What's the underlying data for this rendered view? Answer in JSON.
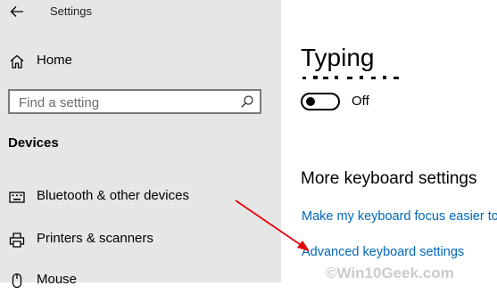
{
  "window": {
    "title": "Settings"
  },
  "sidebar": {
    "home_label": "Home",
    "search_placeholder": "Find a setting",
    "section_heading": "Devices",
    "items": [
      {
        "label": "Bluetooth & other devices",
        "icon": "keyboard-icon"
      },
      {
        "label": "Printers & scanners",
        "icon": "printer-icon"
      },
      {
        "label": "Mouse",
        "icon": "mouse-icon"
      }
    ]
  },
  "main": {
    "page_title": "Typing",
    "toggle": {
      "state": "Off",
      "checked": false
    },
    "section_heading": "More keyboard settings",
    "links": [
      {
        "label": "Make my keyboard focus easier to use"
      },
      {
        "label": "Advanced keyboard settings"
      }
    ]
  },
  "watermark": "©Win10Geek.com",
  "colors": {
    "sidebar_bg": "#e6e6e6",
    "link": "#0067b8",
    "annotation_arrow": "#e8000b"
  }
}
